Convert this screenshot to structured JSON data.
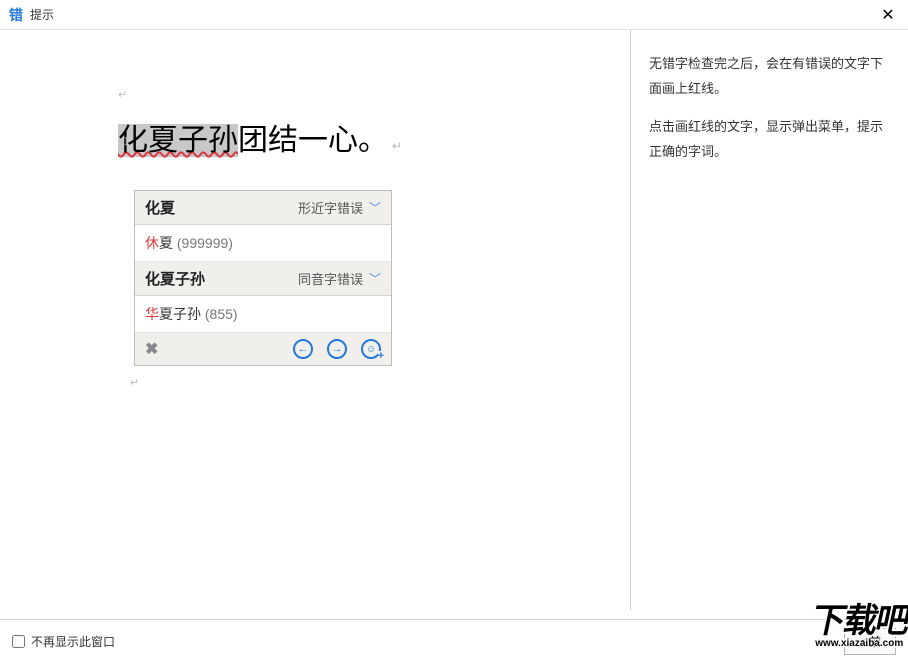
{
  "titlebar": {
    "icon_text": "错",
    "title": "提示"
  },
  "document": {
    "sentence_error": "化夏子孙",
    "sentence_rest": "团结一心。"
  },
  "popup": {
    "group1": {
      "word": "化夏",
      "type": "形近字错误",
      "suggestion_hl": "休",
      "suggestion_rest": "夏",
      "suggestion_freq": " (999999)"
    },
    "group2": {
      "word": "化夏子孙",
      "type": "同音字错误",
      "suggestion_hl": "华",
      "suggestion_rest": "夏子孙",
      "suggestion_freq": " (855)"
    },
    "toolbar": {
      "del_glyph": "✖",
      "prev_glyph": "←",
      "next_glyph": "→",
      "smile_glyph": "☺"
    }
  },
  "help": {
    "p1": "无错字检查完之后，会在有错误的文字下面画上红线。",
    "p2": "点击画红线的文字，显示弹出菜单，提示正确的字词。"
  },
  "bottom": {
    "dontshow_label": "不再显示此窗口",
    "prev_btn": "< 前"
  },
  "watermark": {
    "main": "下载吧",
    "sub": "www.xiazaiba.com"
  }
}
